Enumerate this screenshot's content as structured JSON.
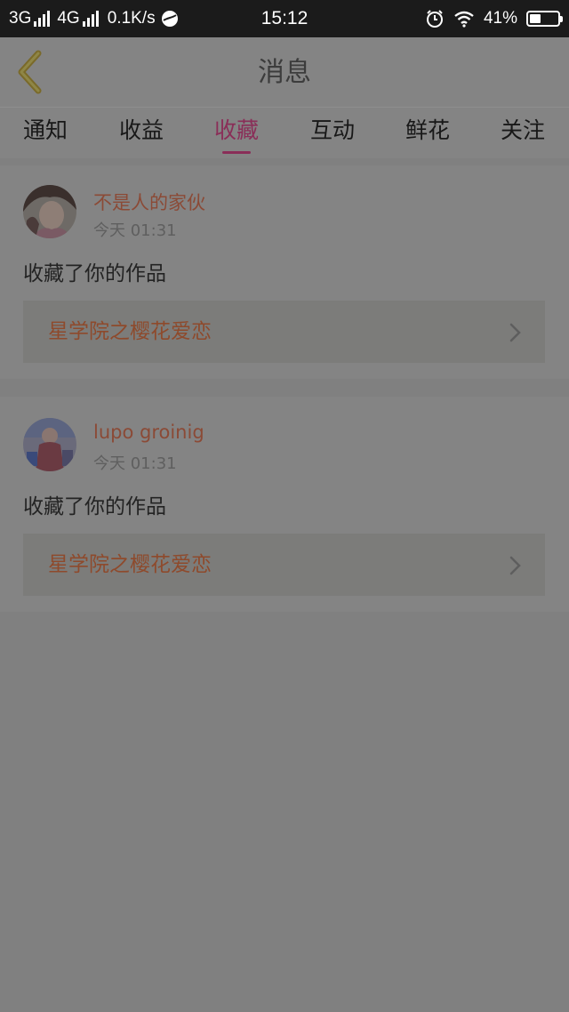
{
  "status_bar": {
    "network_1": "3G",
    "network_2": "4G",
    "speed": "0.1K/s",
    "time": "15:12",
    "battery": "41%",
    "battery_level": 0.41
  },
  "header": {
    "title": "消息"
  },
  "tabs": [
    {
      "label": "通知"
    },
    {
      "label": "收益"
    },
    {
      "label": "收藏"
    },
    {
      "label": "互动"
    },
    {
      "label": "鲜花"
    },
    {
      "label": "关注"
    }
  ],
  "active_tab": "收藏",
  "messages": [
    {
      "username": "不是人的家伙",
      "time": "今天 01:31",
      "action": "收藏了你的作品",
      "work_title": "星学院之樱花爱恋"
    },
    {
      "username": "lupo groinig",
      "time": "今天 01:31",
      "action": "收藏了你的作品",
      "work_title": "星学院之樱花爱恋"
    }
  ],
  "colors": {
    "accent": "#8a2e58",
    "username": "#8b4a36",
    "work_title": "#8e4a2c",
    "overlay_background": "#808080"
  },
  "icons": {
    "back": "back-arrow-icon",
    "chevron": "chevron-right-icon"
  }
}
